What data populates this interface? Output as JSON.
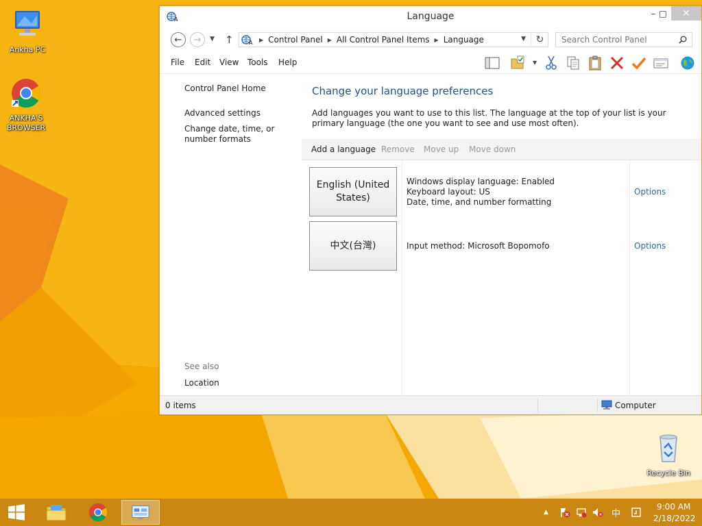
{
  "desktop": {
    "icons": [
      {
        "label": "Ankha PC",
        "icon": "computer-icon"
      },
      {
        "label": "ANKHA'S BROWSER",
        "icon": "chrome-icon"
      },
      {
        "label": "Recycle Bin",
        "icon": "recycle-bin-icon"
      }
    ]
  },
  "window": {
    "title": "Language",
    "controls": {
      "minimize": "–",
      "maximize": "□",
      "close": "✕"
    }
  },
  "address": {
    "breadcrumbs": [
      "Control Panel",
      "All Control Panel Items",
      "Language"
    ],
    "search_placeholder": "Search Control Panel"
  },
  "menu": [
    "File",
    "Edit",
    "View",
    "Tools",
    "Help"
  ],
  "toolbar_icons": [
    "panel-layout-icon",
    "folder-check-icon",
    "cut-icon",
    "copy-icon",
    "paste-icon",
    "delete-icon",
    "checkmark-icon",
    "properties-icon",
    "globe-icon"
  ],
  "sidebar": {
    "links": [
      "Control Panel Home",
      "Advanced settings",
      "Change date, time, or number formats"
    ],
    "see_also_label": "See also",
    "see_also_links": [
      "Location"
    ]
  },
  "main": {
    "heading": "Change your language preferences",
    "description": "Add languages you want to use to this list. The language at the top of your list is your primary language (the one you want to see and use most often).",
    "actions": [
      {
        "label": "Add a language",
        "enabled": true
      },
      {
        "label": "Remove",
        "enabled": false
      },
      {
        "label": "Move up",
        "enabled": false
      },
      {
        "label": "Move down",
        "enabled": false
      }
    ],
    "languages": [
      {
        "name": "English (United States)",
        "details": [
          "Windows display language: Enabled",
          "Keyboard layout: US",
          "Date, time, and number formatting"
        ],
        "options_label": "Options"
      },
      {
        "name": "中文(台灣)",
        "details": [
          "Input method: Microsoft Bopomofo"
        ],
        "options_label": "Options"
      }
    ]
  },
  "status": {
    "items": "0 items",
    "location": "Computer"
  },
  "taskbar": {
    "apps": [
      "start-icon",
      "file-explorer-icon",
      "chrome-icon",
      "control-panel-icon"
    ],
    "tray_icons": [
      "tray-overflow-icon",
      "action-center-icon",
      "network-icon",
      "volume-muted-icon",
      "ime-icon",
      "display-icon"
    ],
    "ime_label": "中",
    "time": "9:00 AM",
    "date": "2/18/2022"
  },
  "colors": {
    "heading_blue": "#1e4f8c",
    "link_blue": "#2c6aa8",
    "wallpaper_orange": "#f2a600",
    "taskbar": "#c48412"
  }
}
